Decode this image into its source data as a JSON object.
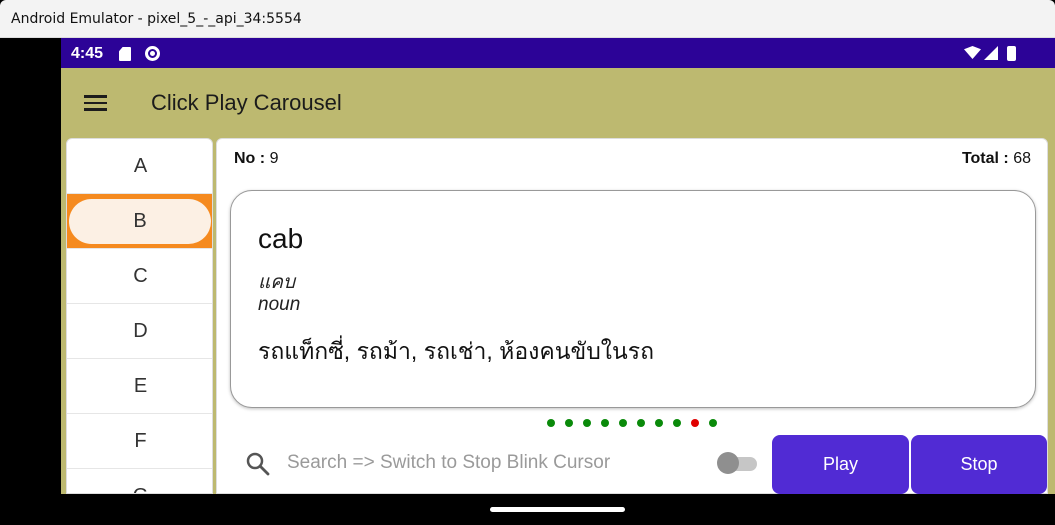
{
  "window": {
    "title": "Android Emulator - pixel_5_-_api_34:5554"
  },
  "status_bar": {
    "time": "4:45"
  },
  "app_bar": {
    "title": "Click Play Carousel"
  },
  "sidebar": {
    "letters": [
      "A",
      "B",
      "C",
      "D",
      "E",
      "F",
      "G"
    ],
    "selected": "B"
  },
  "info": {
    "no_label": "No :",
    "no_value": "9",
    "total_label": "Total :",
    "total_value": "68"
  },
  "card": {
    "word": "cab",
    "pronunciation": "แคบ",
    "part_of_speech": "noun",
    "meaning": "รถแท็กซี่, รถม้า, รถเช่า, ห้องคนขับในรถ"
  },
  "carousel": {
    "dot_count": 10,
    "active_index": 8,
    "dot_color": "#0a8a0a",
    "active_color": "#e00000"
  },
  "search": {
    "placeholder": "Search => Switch to Stop Blink Cursor",
    "value": ""
  },
  "toggle": {
    "on": false
  },
  "buttons": {
    "play_label": "Play",
    "stop_label": "Stop",
    "color": "#512bd4"
  },
  "colors": {
    "status_bar": "#2c0397",
    "app_bar": "#bdb970",
    "selected_letter": "#f58a1f"
  }
}
